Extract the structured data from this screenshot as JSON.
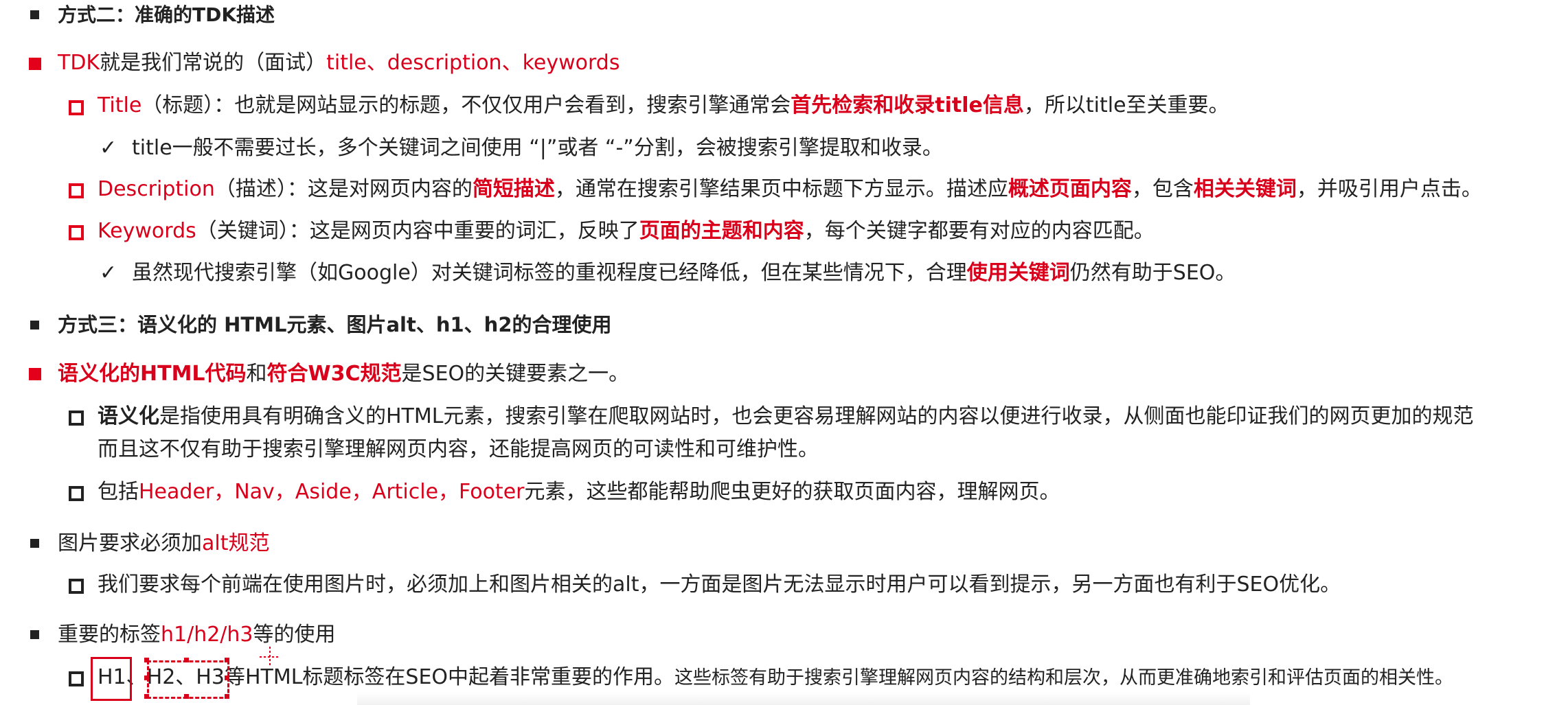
{
  "s2": {
    "heading": "方式二：准确的TDK描述",
    "tdk": {
      "a": "TDK",
      "b": "就是我们常说的（面试）",
      "c": "title、description、keywords"
    },
    "title_item": {
      "a": "Title",
      "b": "（标题）：也就是网站显示的标题，不仅仅用户会看到，搜索引擎通常会",
      "c": "首先检索和收录title信息",
      "d": "，所以title至关重要。"
    },
    "title_check": "title一般不需要过长，多个关键词之间使用 “|”或者 “-”分割，会被搜索引擎提取和收录。",
    "desc_item": {
      "a": "Description",
      "b": "（描述）：这是对网页内容的",
      "c": "简短描述",
      "d": "，通常在搜索引擎结果页中标题下方显示。描述应",
      "e": "概述页面内容",
      "f": "，包含",
      "g": "相关关键词",
      "h": "，并吸引用户点击。"
    },
    "kw_item": {
      "a": "Keywords",
      "b": "（关键词）：这是网页内容中重要的词汇，反映了",
      "c": "页面的主题和内容",
      "d": "，每个关键字都要有对应的内容匹配。"
    },
    "kw_check": {
      "a": "虽然现代搜索引擎（如Google）对关键词标签的重视程度已经降低，但在某些情况下，合理",
      "b": "使用关键词",
      "c": "仍然有助于SEO。"
    }
  },
  "s3": {
    "heading": "方式三：语义化的 HTML元素、图片alt、h1、h2的合理使用",
    "semantic": {
      "a": "语义化的HTML代码",
      "b": "和",
      "c": "符合W3C规范",
      "d": "是SEO的关键要素之一。"
    },
    "sem_item": {
      "a": "语义化",
      "b": "是指使用具有明确含义的HTML元素，搜索引擎在爬取网站时，也会更容易理解网站的内容以便进行收录，从侧面也能印证我们的网页更加的规范",
      "c": "而且这不仅有助于搜索引擎理解网页内容，还能提高网页的可读性和可维护性。"
    },
    "incl_item": {
      "a": "包括",
      "b": "Header，Nav，Aside，Article，Footer",
      "c": "元素，这些都能帮助爬虫更好的获取页面内容，理解网页。"
    },
    "img": {
      "a": "图片要求必须加",
      "b": "alt规范"
    },
    "img_item": "我们要求每个前端在使用图片时，必须加上和图片相关的alt，一方面是图片无法显示时用户可以看到提示，另一方面也有利于SEO优化。",
    "h": {
      "a": "重要的标签",
      "b": "h1/h2/h3",
      "c": "等的使用"
    },
    "h_item": {
      "a": "H1",
      "b": "、",
      "c": "H2、H3",
      "d": "等HTML标题标签在SEO中起着非常重要的作用。",
      "e": "这些标签有助于搜索引擎理解网页内容的结构和层次，从而更准确地索引和评估页面的相关性。"
    }
  },
  "colors": {
    "accent": "#d9001b",
    "text": "#222222"
  }
}
